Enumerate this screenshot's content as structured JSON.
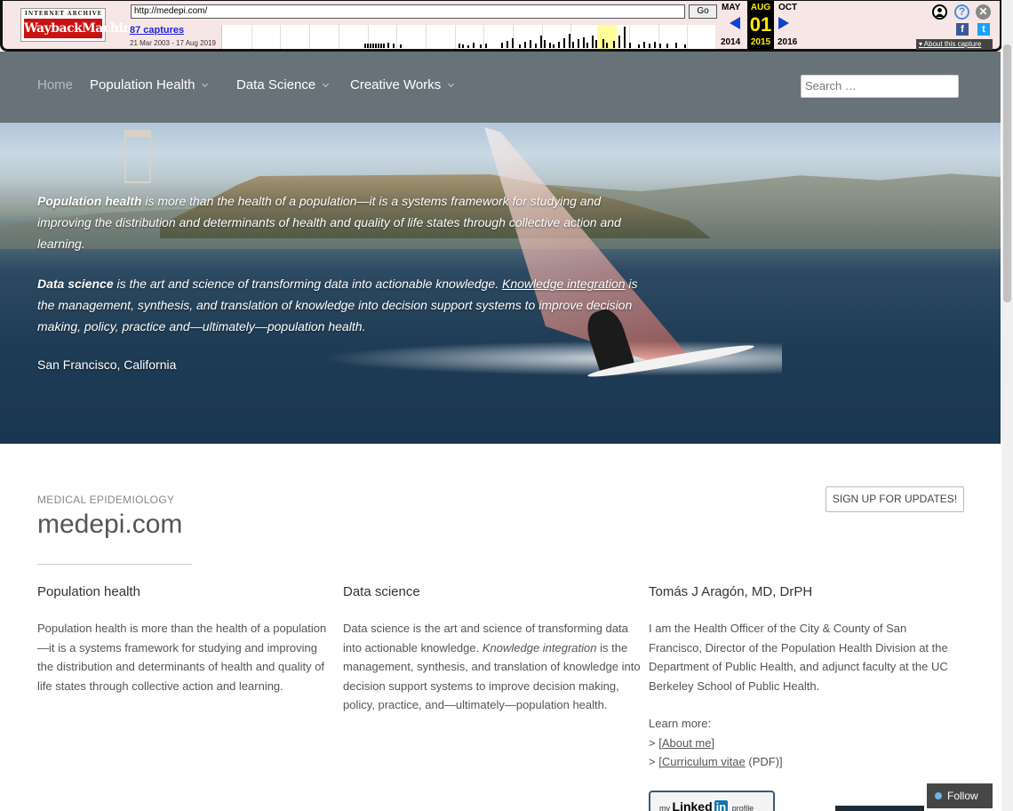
{
  "wayback": {
    "logo_top": "INTERNET ARCHIVE",
    "logo_main": "WaybackMachine",
    "url": "http://medepi.com/",
    "go": "Go",
    "captures": "87 captures",
    "range": "21 Mar 2003 - 17 Aug 2019",
    "prev_month": "MAY",
    "cur_month": "AUG",
    "next_month": "OCT",
    "cur_day": "01",
    "prev_year": "2014",
    "cur_year": "2015",
    "next_year": "2016",
    "about": "About this capture",
    "icons": [
      "user-icon",
      "help-icon",
      "close-icon",
      "facebook-icon",
      "twitter-icon"
    ],
    "facebook_glyph": "f",
    "twitter_glyph": "t",
    "help_glyph": "?",
    "close_glyph": "✕"
  },
  "nav": {
    "home": "Home",
    "items": [
      "Population Health",
      "Data Science",
      "Creative Works"
    ],
    "search_placeholder": "Search …"
  },
  "hero": {
    "p1_bold": "Population health",
    "p1_rest": " is more than the health of a population—it is a systems framework for studying and improving the distribution and determinants of health and quality of life states through collective action and learning.",
    "p2_bold": "Data science",
    "p2_mid": " is the art and science of transforming data into actionable knowledge. ",
    "p2_link": "Knowledge integration",
    "p2_rest": " is the management, synthesis, and translation of knowledge into decision support systems to improve decision making, policy, practice and—ultimately—population health.",
    "location": "San Francisco, California"
  },
  "site": {
    "tagline": "MEDICAL EPIDEMIOLOGY",
    "title": "medepi.com",
    "signup": "SIGN UP FOR UPDATES!"
  },
  "columns": {
    "c1_title": "Population health",
    "c1_text": "Population health is more than the health of a population—it is a systems framework for studying and improving the distribution and determinants of health and quality of life states through collective action and learning.",
    "c2_title": "Data science",
    "c2_a": "Data science is the art and science of transforming data into actionable knowledge. ",
    "c2_em": "Knowledge integration",
    "c2_b": " is the management, synthesis, and translation of knowledge into decision support systems to improve decision making, policy, practice, and—ultimately—population health.",
    "c3_title": "Tomás J Aragón, MD, DrPH",
    "c3_text": "I am the Health Officer of the City & County of San Francisco, Director of the Population Health Division at the Department of Public Health, and adjunct faculty at the UC Berkeley School of Public Health.",
    "learn_more": "Learn more:",
    "link1": "About me",
    "link2": "Curriculum vitae",
    "link2_suffix": " (PDF)]",
    "prefix": "> [",
    "suffix": "]"
  },
  "linkedin": {
    "my": "my",
    "brand": "Linked",
    "in": "in",
    "profile": "profile"
  },
  "follow": "Follow"
}
